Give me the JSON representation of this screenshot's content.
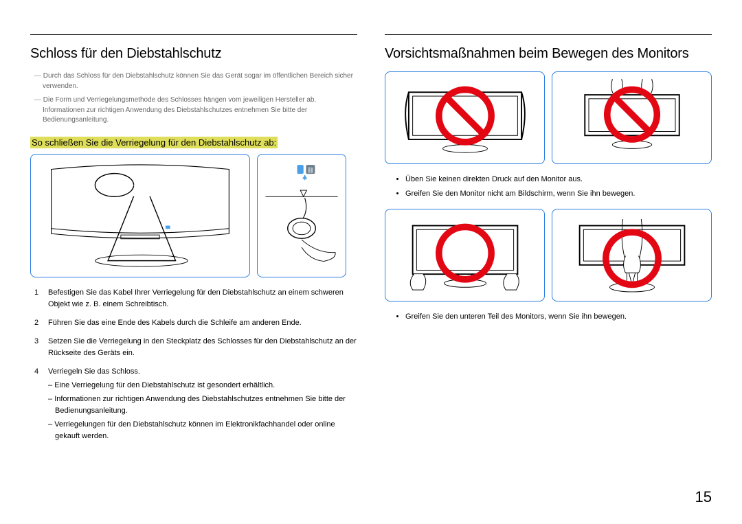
{
  "page_number": "15",
  "left": {
    "heading": "Schloss für den Diebstahlschutz",
    "note1": "Durch das Schloss für den Diebstahlschutz können Sie das Gerät sogar im öffentlichen Bereich sicher verwenden.",
    "note2": "Die Form und Verriegelungsmethode des Schlosses hängen vom jeweiligen Hersteller ab. Informationen zur richtigen Anwendung des Diebstahlschutzes entnehmen Sie bitte der Bedienungsanleitung.",
    "subheading": "So schließen Sie die Verriegelung für den Diebstahlschutz ab:",
    "steps": [
      "Befestigen Sie das Kabel Ihrer Verriegelung für den Diebstahlschutz an einem schweren Objekt wie z. B. einem Schreibtisch.",
      "Führen Sie das eine Ende des Kabels durch die Schleife am anderen Ende.",
      "Setzen Sie die Verriegelung in den Steckplatz des Schlosses für den Diebstahlschutz an der Rückseite des Geräts ein.",
      "Verriegeln Sie das Schloss."
    ],
    "subnotes": [
      "Eine Verriegelung für den Diebstahlschutz ist gesondert erhältlich.",
      "Informationen zur richtigen Anwendung des Diebstahlschutzes entnehmen Sie bitte der Bedienungsanleitung.",
      "Verriegelungen für den Diebstahlschutz können im Elektronikfachhandel oder online gekauft werden."
    ]
  },
  "right": {
    "heading": "Vorsichtsmaßnahmen beim Bewegen des Monitors",
    "bullets_a": [
      "Üben Sie keinen direkten Druck auf den Monitor aus.",
      "Greifen Sie den Monitor nicht am Bildschirm, wenn Sie ihn bewegen."
    ],
    "bullets_b": [
      "Greifen Sie den unteren Teil des Monitors, wenn Sie ihn bewegen."
    ]
  }
}
